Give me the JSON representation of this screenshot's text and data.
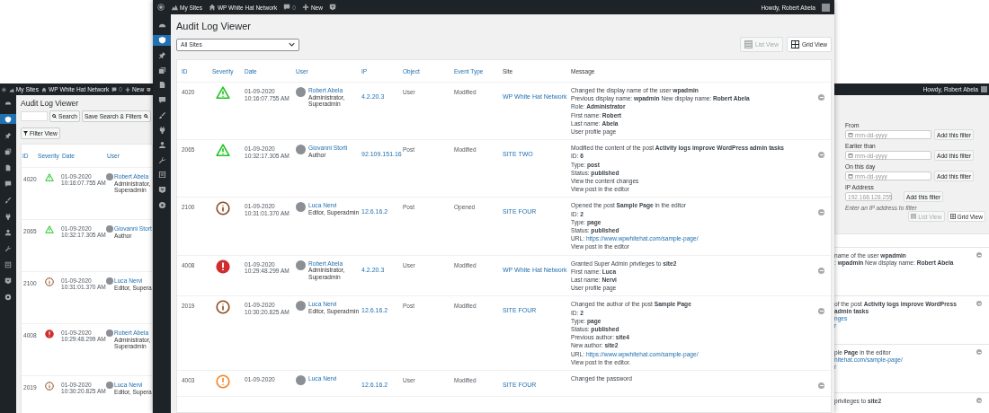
{
  "left_window": {
    "admin_bar": {
      "my_sites": "My Sites",
      "network": "WP White Hat Network",
      "comments": "0",
      "new": "New"
    },
    "sidebar": {
      "items": [
        {
          "selected": false
        },
        {
          "selected": true
        },
        {
          "selected": false
        },
        {
          "selected": false
        },
        {
          "selected": false
        },
        {
          "selected": false
        },
        {
          "selected": false
        },
        {
          "selected": false
        },
        {
          "selected": false
        },
        {
          "selected": false
        },
        {
          "selected": false
        },
        {
          "selected": false
        },
        {
          "selected": false
        }
      ]
    },
    "title": "Audit Log Viewer",
    "search_button": "Search",
    "save_button": "Save Search & Filters",
    "filter_button": "Filter View",
    "columns": [
      "ID",
      "Severity",
      "Date",
      "User"
    ],
    "rows": [
      {
        "id": "4020",
        "kind": "warning",
        "date": "01-09-2020",
        "time": "10:16:07.755 AM",
        "user": "Robert Abela",
        "role_lines": [
          "Administrator,",
          "Superadmin"
        ]
      },
      {
        "id": "2065",
        "kind": "warning",
        "date": "01-09-2020",
        "time": "10:32:17.305 AM",
        "user": "Giovanni Stort",
        "role_lines": [
          "Author"
        ]
      },
      {
        "id": "2100",
        "kind": "notice",
        "date": "01-09-2020",
        "time": "10:31:01.370 AM",
        "user": "Luca Nervi",
        "role_lines": [
          "Editor, Supera"
        ]
      },
      {
        "id": "4008",
        "kind": "critical",
        "date": "01-09-2020",
        "time": "10:29:48.299 AM",
        "user": "Robert Abela",
        "role_lines": [
          "Administrator,",
          "Superadmin"
        ]
      },
      {
        "id": "2019",
        "kind": "notice",
        "date": "01-09-2020",
        "time": "10:30:20.825 AM",
        "user": "Luca Nervi",
        "role_lines": [
          "Editor, Supera"
        ]
      }
    ]
  },
  "main_window": {
    "admin_bar": {
      "my_sites": "My Sites",
      "network": "WP White Hat Network",
      "comments": "0",
      "new": "New",
      "greeting": "Howdy, Robert Abela"
    },
    "sidebar": {
      "items": [
        {
          "selected": false
        },
        {
          "selected": true
        },
        {
          "selected": false
        },
        {
          "selected": false
        },
        {
          "selected": false
        },
        {
          "selected": false
        },
        {
          "selected": false
        },
        {
          "selected": false
        },
        {
          "selected": false
        },
        {
          "selected": false
        },
        {
          "selected": false
        },
        {
          "selected": false
        },
        {
          "selected": false
        }
      ]
    },
    "title": "Audit Log Viewer",
    "site_select": "All Sites",
    "view_buttons": [
      {
        "label": "List View",
        "disabled": true
      },
      {
        "label": "Grid View",
        "disabled": false
      }
    ],
    "columns": [
      {
        "label": "ID",
        "sortable": true
      },
      {
        "label": "Severity",
        "sortable": true
      },
      {
        "label": "Date",
        "sortable": true
      },
      {
        "label": "User",
        "sortable": true
      },
      {
        "label": "IP",
        "sortable": true
      },
      {
        "label": "Object",
        "sortable": true
      },
      {
        "label": "Event Type",
        "sortable": true
      },
      {
        "label": "Site",
        "sortable": false
      },
      {
        "label": "Message",
        "sortable": false
      }
    ],
    "rows": [
      {
        "id": "4020",
        "kind": "warning",
        "date": "01-09-2020",
        "time": "10:16:07.755 AM",
        "user": "Robert Abela",
        "role_lines": [
          "Administrator,",
          "Superadmin"
        ],
        "ip": "4.2.20.3",
        "object": "User",
        "event_type": "Modified",
        "site": "WP White Hat Network",
        "message": [
          {
            "kind": "text",
            "text": "Changed the display name of the user **wpadmin**"
          },
          {
            "kind": "text",
            "text": "Previous display name: **wpadmin** New display name: **Robert Abela**"
          },
          {
            "kind": "text",
            "text": "Role: **Administrator**"
          },
          {
            "kind": "text",
            "text": "First name: **Robert**"
          },
          {
            "kind": "text",
            "text": "Last name: **Abela**"
          },
          {
            "kind": "link",
            "text": "User profile page"
          }
        ]
      },
      {
        "id": "2065",
        "kind": "warning",
        "date": "01-09-2020",
        "time": "10:32:17.305 AM",
        "user": "Giovanni Storti",
        "role_lines": [
          "Author"
        ],
        "ip": "92.109.151.16",
        "object": "Post",
        "event_type": "Modified",
        "site": "SITE TWO",
        "message": [
          {
            "kind": "text",
            "text": "Modified the content of the post **Activity logs improve WordPress admin tasks**"
          },
          {
            "kind": "text",
            "text": "ID: **6**"
          },
          {
            "kind": "text",
            "text": "Type: **post**"
          },
          {
            "kind": "text",
            "text": "Status: **published**"
          },
          {
            "kind": "link",
            "text": "View the content changes"
          },
          {
            "kind": "link",
            "text": "View post in the editor"
          }
        ]
      },
      {
        "id": "2100",
        "kind": "notice",
        "date": "01-09-2020",
        "time": "10:31:01.370 AM",
        "user": "Luca Nervi",
        "role_lines": [
          "Editor, Superadmin"
        ],
        "ip": "12.6.16.2",
        "object": "Post",
        "event_type": "Opened",
        "site": "SITE FOUR",
        "message": [
          {
            "kind": "text",
            "text": "Opened the post **Sample Page** in the editor"
          },
          {
            "kind": "text",
            "text": "ID: **2**"
          },
          {
            "kind": "text",
            "text": "Type: **page**"
          },
          {
            "kind": "text",
            "text": "Status: **published**"
          },
          {
            "kind": "url",
            "label": "URL:",
            "text": "https://www.wpwhitehat.com/sample-page/"
          },
          {
            "kind": "link",
            "text": "View post in the editor"
          }
        ]
      },
      {
        "id": "4008",
        "kind": "critical",
        "date": "01-09-2020",
        "time": "10:29:48.299 AM",
        "user": "Robert Abela",
        "role_lines": [
          "Administrator,",
          "Superadmin"
        ],
        "ip": "4.2.20.3",
        "object": "User",
        "event_type": "Modified",
        "site": "WP White Hat Network",
        "message": [
          {
            "kind": "text",
            "text": "Granted Super Admin privileges to **site2**"
          },
          {
            "kind": "text",
            "text": "First name: **Luca**"
          },
          {
            "kind": "text",
            "text": "Last name: **Nervi**"
          },
          {
            "kind": "link",
            "text": "User profile page"
          }
        ]
      },
      {
        "id": "2019",
        "kind": "notice",
        "date": "01-09-2020",
        "time": "10:30:20.825 AM",
        "user": "Luca Nervi",
        "role_lines": [
          "Editor, Superadmin"
        ],
        "ip": "12.6.16.2",
        "object": "Post",
        "event_type": "Modified",
        "site": "SITE FOUR",
        "message": [
          {
            "kind": "text",
            "text": "Changed the author of the post **Sample Page**"
          },
          {
            "kind": "text",
            "text": "ID: **2**"
          },
          {
            "kind": "text",
            "text": "Type: **page**"
          },
          {
            "kind": "text",
            "text": "Status: **published**"
          },
          {
            "kind": "text",
            "text": "Previous author: **site4**"
          },
          {
            "kind": "text",
            "text": "New author: **site2**"
          },
          {
            "kind": "url",
            "label": "URL:",
            "text": "https://www.wpwhitehat.com/sample-page/"
          },
          {
            "kind": "link",
            "text": "View post in the editor."
          }
        ]
      },
      {
        "id": "4003",
        "kind": "alert",
        "date": "01-09-2020",
        "user": "Luca Nervi",
        "role_lines": [],
        "ip": "12.6.16.2",
        "object": "User",
        "event_type": "Modified",
        "site": "SITE FOUR",
        "message": [
          {
            "kind": "text",
            "text": "Changed the password"
          }
        ]
      }
    ]
  },
  "right_window": {
    "admin_bar": {
      "greeting": "Howdy, Robert Abela"
    },
    "filters": [
      {
        "kind": "date",
        "label": "From",
        "placeholder": "mm-dd-yyyy",
        "button": "Add this filter"
      },
      {
        "kind": "date",
        "label": "Earlier than",
        "placeholder": "mm-dd-yyyy",
        "button": "Add this filter"
      },
      {
        "kind": "date",
        "label": "On this day",
        "placeholder": "mm-dd-yyyy",
        "button": "Add this filter"
      },
      {
        "kind": "text",
        "label": "IP Address",
        "placeholder": "192.168.128.255",
        "button": "Add this filter"
      }
    ],
    "hint": "Enter an IP address to filter",
    "view_buttons": [
      {
        "label": "List View",
        "disabled": true
      },
      {
        "label": "Grid View",
        "disabled": false
      }
    ],
    "rows": [
      {
        "lines": [
          {
            "kind": "text",
            "text": "name of the user **wpadmin**"
          },
          {
            "kind": "text",
            "text": ": **wpadmin** New display name: **Robert Abela**"
          }
        ]
      },
      {
        "lines": [
          {
            "kind": "text",
            "text": "of the post **Activity logs improve WordPress admin tasks**"
          },
          {
            "kind": "link",
            "text": "nges"
          },
          {
            "kind": "link",
            "text": "r"
          }
        ]
      },
      {
        "lines": [
          {
            "kind": "text",
            "text": "ple **Page** in the editor"
          },
          {
            "kind": "link",
            "text": "hitehat.com/sample-page/"
          },
          {
            "kind": "link",
            "text": "r"
          }
        ]
      },
      {
        "lines": [
          {
            "kind": "text",
            "text": "privileges to **site2**"
          }
        ]
      }
    ]
  }
}
